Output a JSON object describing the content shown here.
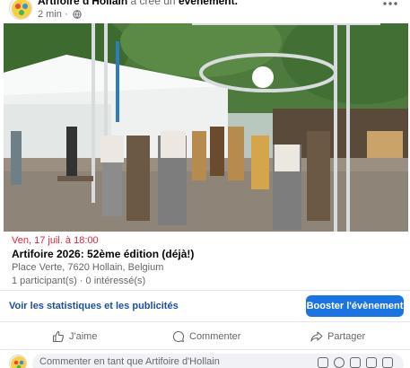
{
  "post": {
    "author": "Artifoire d'Hollain",
    "action": "a créé un",
    "object": "évènement.",
    "time": "2 min",
    "more_icon": "ellipsis-icon",
    "visibility_icon": "globe-icon"
  },
  "event": {
    "date": "Ven, 17 juil. à 18:00",
    "title": "Artifoire 2026: 52ème édition (déjà!)",
    "location": "Place Verte, 7620 Hollain, Belgium",
    "attendance": "1 participant(s) · 0 intéressé(s)"
  },
  "stats": {
    "link": "Voir les statistiques et les publicités",
    "boost": "Booster l'évènement"
  },
  "actions": {
    "like": "J'aime",
    "comment": "Commenter",
    "share": "Partager"
  },
  "comment_box": {
    "placeholder": "Commenter en tant que Artifoire d'Hollain",
    "icons": [
      "sticker-icon",
      "emoji-icon",
      "camera-icon",
      "gif-icon",
      "stickers-icon"
    ]
  },
  "colors": {
    "accent": "#1b74e4",
    "date_red": "#e41e3f",
    "link_blue": "#1b4fa0"
  }
}
